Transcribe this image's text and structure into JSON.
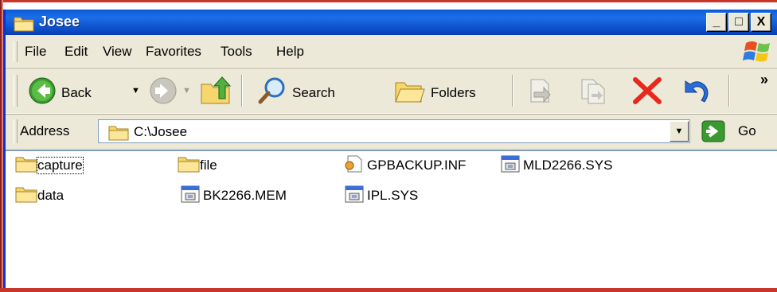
{
  "window": {
    "title": "Josee",
    "buttons": {
      "minimize": "_",
      "maximize": "□",
      "close": "X"
    }
  },
  "menu": [
    "File",
    "Edit",
    "View",
    "Favorites",
    "Tools",
    "Help"
  ],
  "toolbar": {
    "back_label": "Back",
    "search_label": "Search",
    "folders_label": "Folders",
    "overflow_label": "»"
  },
  "address": {
    "label": "Address",
    "value": "C:\\Josee",
    "go_label": "Go"
  },
  "files": [
    {
      "name": "capture",
      "type": "folder"
    },
    {
      "name": "file",
      "type": "folder"
    },
    {
      "name": "GPBACKUP.INF",
      "type": "inf"
    },
    {
      "name": "MLD2266.SYS",
      "type": "sys"
    },
    {
      "name": "data",
      "type": "folder"
    },
    {
      "name": "BK2266.MEM",
      "type": "sys"
    },
    {
      "name": "IPL.SYS",
      "type": "sys"
    }
  ],
  "colors": {
    "title_bar": "#0a5bd8",
    "chrome": "#ece9d8",
    "frame_accent": "#c8352a",
    "folder": "#f5d76e"
  }
}
